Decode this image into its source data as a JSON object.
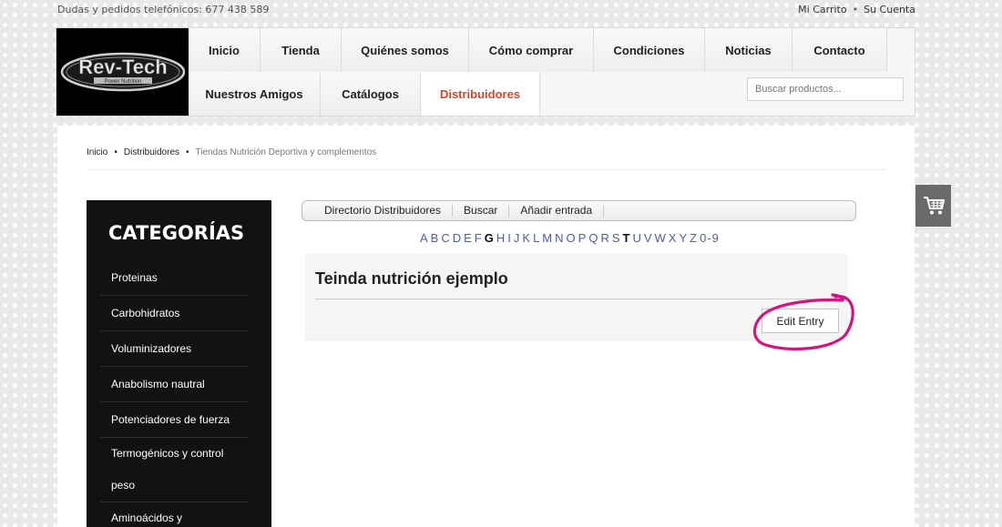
{
  "topbar": {
    "phone": "Dudas y pedidos telefónicos: 677 438 589",
    "cart_link": "Mi Carrito",
    "separator": "•",
    "account_link": "Su Cuenta"
  },
  "logo": {
    "text": "Rev-Tech",
    "subtext": "Power Nutrition"
  },
  "nav": {
    "row1": [
      "Inicio",
      "Tienda",
      "Quiénes somos",
      "Cómo comprar",
      "Condiciones",
      "Noticias",
      "Contacto"
    ],
    "row2": [
      "Nuestros Amigos",
      "Catálogos",
      "Distribuidores"
    ],
    "active": "Distribuidores"
  },
  "search": {
    "placeholder": "Buscar productos..."
  },
  "breadcrumb": {
    "items": [
      "Inicio",
      "Distribuidores"
    ],
    "current": "Tiendas Nutrición Deportiva y complementos",
    "separator": "•"
  },
  "sidebar": {
    "title": "CATEGORÍAS",
    "items": [
      "Proteinas",
      "Carbohidratos",
      "Voluminizadores",
      "Anabolismo nautral",
      "Potenciadores de fuerza",
      "Termogénicos y control",
      "peso",
      "Aminoácidos y"
    ]
  },
  "directory": {
    "tabs": [
      "Directorio Distribuidores",
      "Buscar",
      "Añadir entrada"
    ],
    "letters": [
      "A",
      "B",
      "C",
      "D",
      "E",
      "F",
      "G",
      "H",
      "I",
      "J",
      "K",
      "L",
      "M",
      "N",
      "O",
      "P",
      "Q",
      "R",
      "S",
      "T",
      "U",
      "V",
      "W",
      "X",
      "Y",
      "Z",
      "0-9"
    ],
    "bold_letters": [
      "G",
      "T"
    ]
  },
  "entry": {
    "title": "Teinda nutrición ejemplo",
    "edit_button": "Edit Entry"
  },
  "colors": {
    "active_nav": "#d9452a",
    "highlight": "#d4147f",
    "sidebar_bg": "#121212",
    "link_blue": "#4a5fa0"
  },
  "icons": {
    "cart_float": "cart-icon"
  }
}
